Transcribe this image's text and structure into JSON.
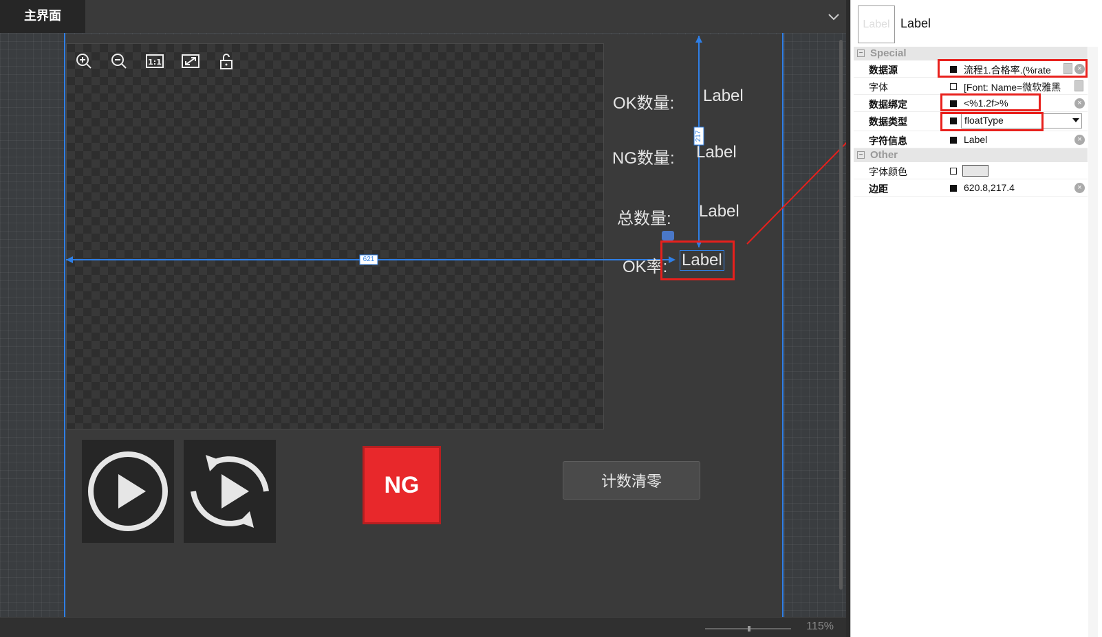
{
  "tabbar": {
    "tab_main": "主界面"
  },
  "labels": {
    "ok_count": "OK数量:",
    "ng_count": "NG数量:",
    "total": "总数量:",
    "ok_rate": "OK率:"
  },
  "values": {
    "ok_count": "Label",
    "ng_count": "Label",
    "total": "Label",
    "ok_rate": "Label"
  },
  "guides": {
    "horizontal_distance": "621",
    "vertical_distance": "217"
  },
  "ng_indicator": "NG",
  "reset_button": "计数清零",
  "statusbar": {
    "zoom": "115%"
  },
  "props": {
    "thumb": "Label",
    "title": "Label",
    "group_special": "Special",
    "group_other": "Other",
    "rows": [
      {
        "name": "数据源",
        "value": "流程1.合格率.(%rate"
      },
      {
        "name": "字体",
        "value": "[Font: Name=微软雅黑"
      },
      {
        "name": "数据绑定",
        "value": " <%1.2f>%"
      },
      {
        "name": "数据类型",
        "value": "floatType"
      },
      {
        "name": "字符信息",
        "value": "Label"
      },
      {
        "name": "字体颜色",
        "value": ""
      },
      {
        "name": "边距",
        "value": "620.8,217.4"
      }
    ]
  },
  "colors": {
    "accent": "#2f7fe6",
    "highlight": "#e8201c",
    "ng": "#e8282b"
  },
  "icons": [
    "zoom-in-icon",
    "zoom-out-icon",
    "actual-size-icon",
    "fit-icon",
    "unlock-icon",
    "play-icon",
    "replay-icon",
    "chevron-down-icon"
  ]
}
